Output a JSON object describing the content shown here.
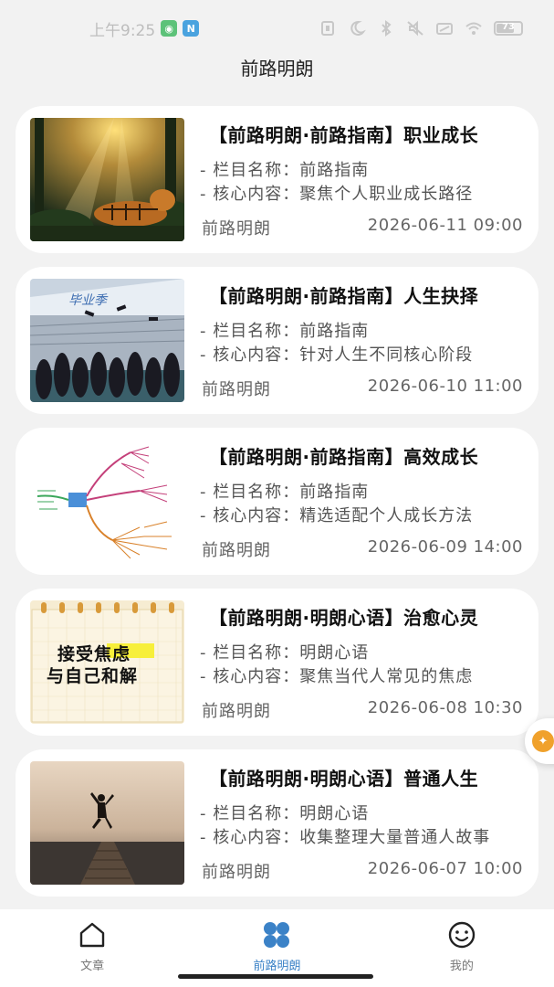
{
  "status_bar": {
    "time": "上午9:25",
    "battery": "73"
  },
  "header": {
    "title": "前路明朗"
  },
  "articles": [
    {
      "title": "【前路明朗·前路指南】职业成长",
      "column": "- 栏目名称：前路指南",
      "content": "- 核心内容：聚焦个人职业成长路径",
      "source": "前路明朗",
      "date": "2026-06-11 09:00",
      "image": "tiger-forest-image"
    },
    {
      "title": "【前路明朗·前路指南】人生抉择",
      "column": "- 栏目名称：前路指南",
      "content": "- 核心内容：针对人生不同核心阶段",
      "source": "前路明朗",
      "date": "2026-06-10 11:00",
      "image": "graduation-image"
    },
    {
      "title": "【前路明朗·前路指南】高效成长",
      "column": "- 栏目名称：前路指南",
      "content": "- 核心内容：精选适配个人成长方法",
      "source": "前路明朗",
      "date": "2026-06-09 14:00",
      "image": "mindmap-image"
    },
    {
      "title": "【前路明朗·明朗心语】治愈心灵",
      "column": "- 栏目名称：明朗心语",
      "content": "- 核心内容：聚焦当代人常见的焦虑",
      "source": "前路明朗",
      "date": "2026-06-08 10:30",
      "image": "notebook-image",
      "image_text_1": "接受焦虑",
      "image_text_2": "与自己和解"
    },
    {
      "title": "【前路明朗·明朗心语】普通人生",
      "column": "- 栏目名称：明朗心语",
      "content": "- 核心内容：收集整理大量普通人故事",
      "source": "前路明朗",
      "date": "2026-06-07 10:00",
      "image": "jumping-person-image"
    }
  ],
  "bottom_nav": {
    "items": [
      {
        "label": "文章",
        "icon": "home-icon"
      },
      {
        "label": "前路明朗",
        "icon": "grid-icon"
      },
      {
        "label": "我的",
        "icon": "smiley-icon"
      }
    ],
    "active_index": 1
  },
  "colors": {
    "accent": "#3b82c7",
    "background": "#f2f2f2"
  }
}
